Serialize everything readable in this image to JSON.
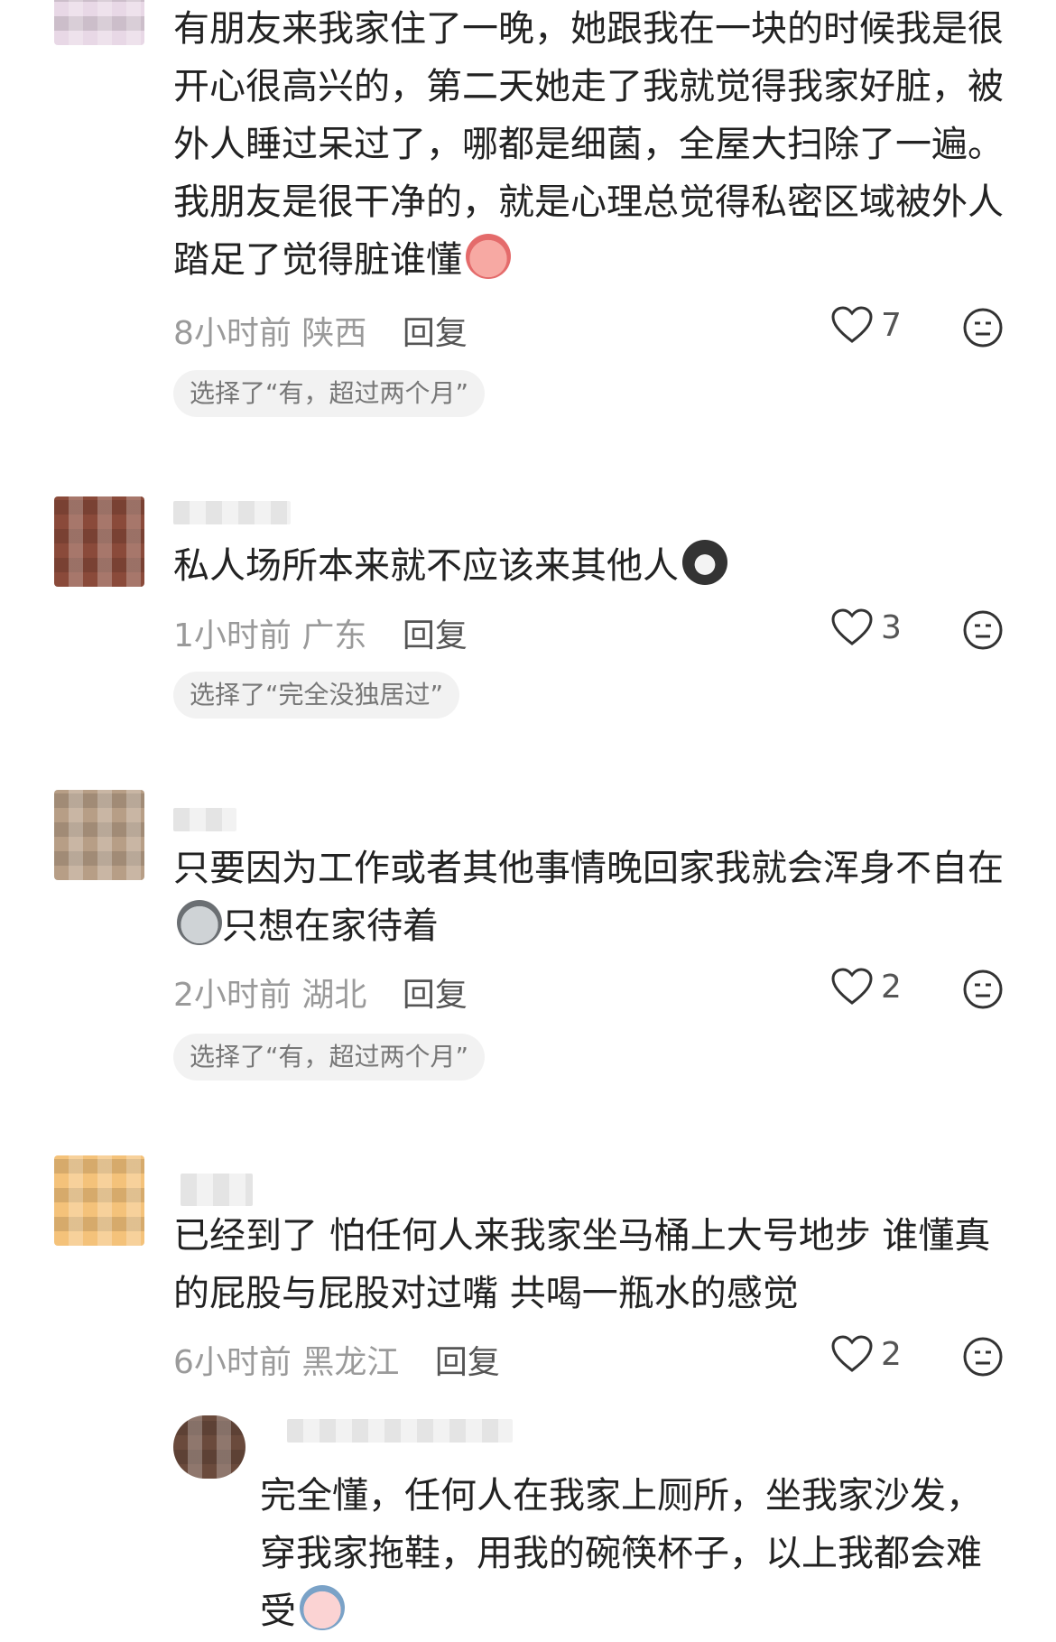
{
  "comments": [
    {
      "text": "有朋友来我家住了一晚，她跟我在一块的时候我是很开心很高兴的，第二天她走了我就觉得我家好脏，被外人睡过呆过了，哪都是细菌，全屋大扫除了一遍。我朋友是很干净的，就是心理总觉得私密区域被外人踏足了觉得脏谁懂",
      "emoji": "crying-face-icon",
      "time": "8小时前",
      "location": "陕西",
      "reply_label": "回复",
      "likes": "7",
      "choice": "选择了“有，超过两个月”"
    },
    {
      "text": "私人场所本来就不应该来其他人",
      "emoji": "cat-face-icon",
      "time": "1小时前",
      "location": "广东",
      "reply_label": "回复",
      "likes": "3",
      "choice": "选择了“完全没独居过”"
    },
    {
      "text": "只要因为工作或者其他事情晚回家我就会浑身不自在",
      "text_after": "只想在家待着",
      "emoji": "ghost-face-icon",
      "time": "2小时前",
      "location": "湖北",
      "reply_label": "回复",
      "likes": "2",
      "choice": "选择了“有，超过两个月”"
    },
    {
      "text": "已经到了 怕任何人来我家坐马桶上大号地步 谁懂真的屁股与屁股对过嘴 共喝一瓶水的感觉",
      "time": "6小时前",
      "location": "黑龙江",
      "reply_label": "回复",
      "likes": "2"
    }
  ],
  "reply": {
    "text": "完全懂，任何人在我家上厕所，坐我家沙发，穿我家拖鞋，用我的碗筷杯子，以上我都会难受",
    "emoji": "sad-face-icon"
  }
}
